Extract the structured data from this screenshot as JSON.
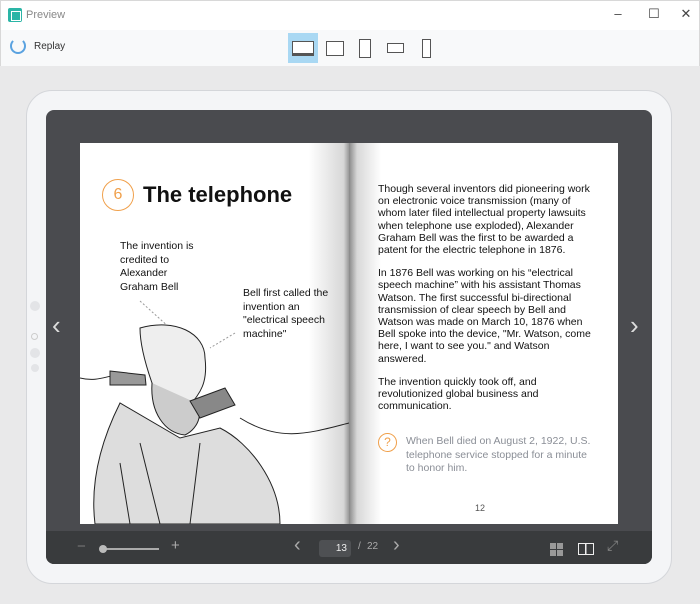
{
  "window": {
    "title": "Preview",
    "minimize": "–",
    "maximize": "☐",
    "close": "✕"
  },
  "toolbar": {
    "replay_label": "Replay",
    "devices": [
      {
        "name": "desktop",
        "active": true
      },
      {
        "name": "tablet-landscape"
      },
      {
        "name": "tablet-portrait"
      },
      {
        "name": "phone-landscape"
      },
      {
        "name": "phone-portrait"
      }
    ]
  },
  "book": {
    "left_page": {
      "chapter_number": "6",
      "title": "The telephone",
      "caption1": "The invention is credited to Alexander Graham Bell",
      "caption2": "Bell first called the invention an \"electrical speech machine\""
    },
    "right_page": {
      "paragraphs": [
        "Though several inventors did pioneering work on electronic voice transmission (many of whom later filed intellectual property lawsuits when telephone use exploded), Alexander Graham Bell was the first to be awarded a patent for the electric telephone in 1876.",
        "In 1876 Bell was working on his “electrical speech machine” with his assistant Thomas Watson. The first successful bi-directional transmission of clear speech by Bell and Watson was made on March 10, 1876 when Bell spoke into the device, \"Mr. Watson, come here, I want to see you.\" and Watson answered.",
        "The invention quickly took off, and revolutionized global business and communication."
      ],
      "note": "When Bell died on August 2, 1922, U.S. telephone service stopped for a minute to honor him.",
      "note_icon": "?",
      "page_number": "12"
    }
  },
  "nav": {
    "prev": "‹",
    "next": "›"
  },
  "bottom": {
    "zoom_out": "−",
    "zoom_in": "+",
    "zoom_level": 0,
    "prev": "‹",
    "next": "›",
    "current_page": "13",
    "separator": "/",
    "total_pages": "22"
  },
  "colors": {
    "accent": "#f0a04b",
    "active_device": "#a9d8f3"
  }
}
